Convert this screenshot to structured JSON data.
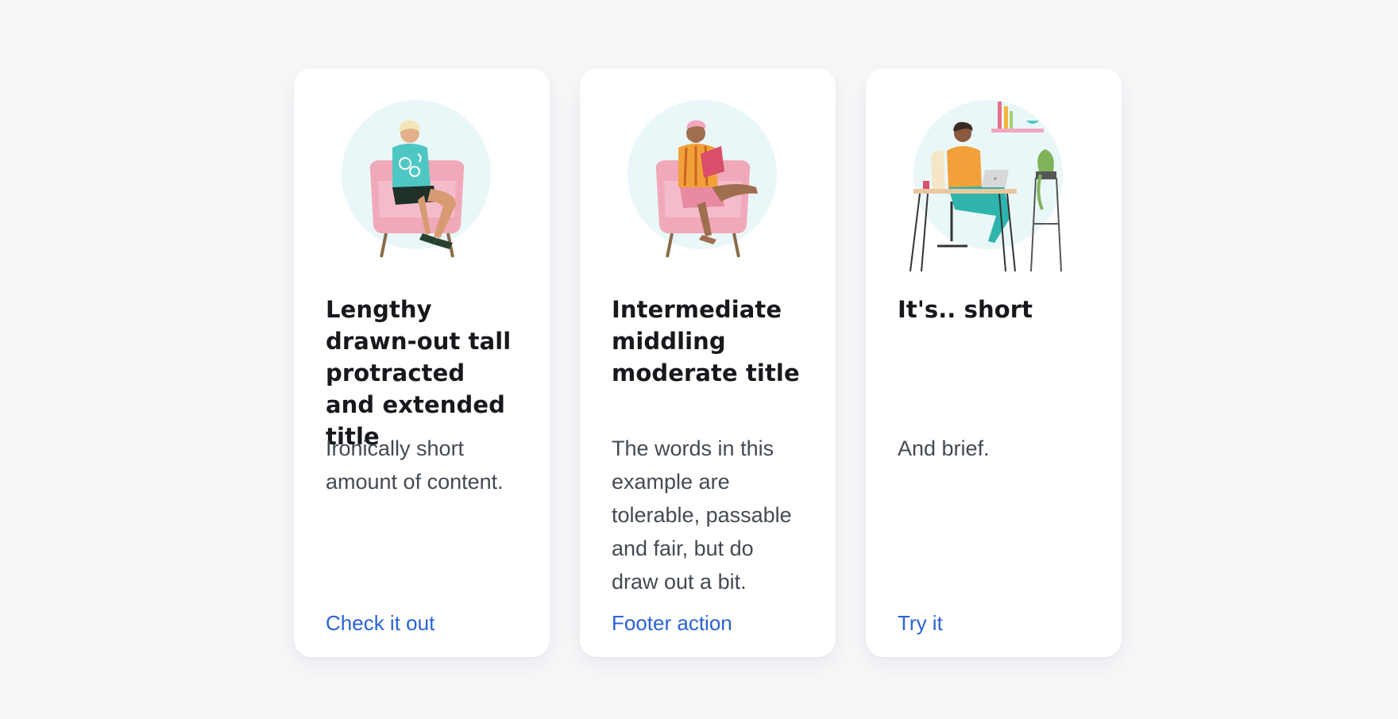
{
  "cards": [
    {
      "title": "Lengthy drawn-out tall protracted and extended title",
      "body": "Ironically short amount of content.",
      "action": "Check it out",
      "illustration": "person-reading-in-armchair"
    },
    {
      "title": "Intermediate middling moderate title",
      "body": "The words in this example are tolerable, passable and fair, but do draw out a bit.",
      "action": "Footer action",
      "illustration": "person-reading-book-in-armchair"
    },
    {
      "title": "It's.. short",
      "body": "And brief.",
      "action": "Try it",
      "illustration": "person-working-at-laptop-desk"
    }
  ],
  "colors": {
    "background": "#f6f7f9",
    "card": "#ffffff",
    "title": "#16181c",
    "body": "#444a52",
    "link": "#2a62d6",
    "circle": "#eaf7f9",
    "chair": "#f0a9b8"
  }
}
